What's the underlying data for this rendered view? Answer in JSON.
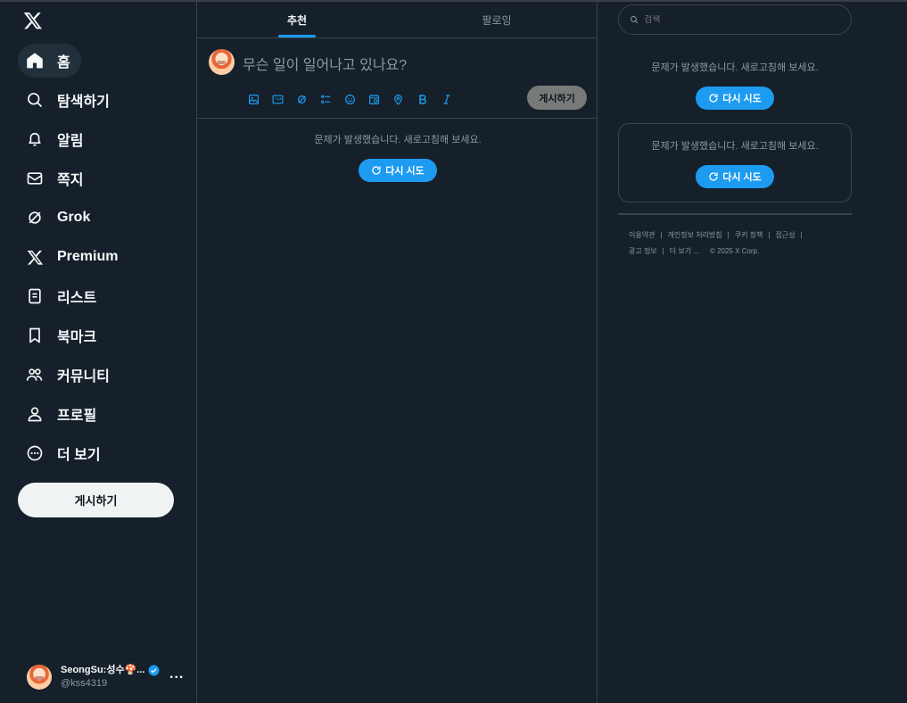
{
  "sidebar": {
    "logo": "x-logo-icon",
    "items": [
      {
        "label": "홈",
        "icon": "home-icon",
        "active": true
      },
      {
        "label": "탐색하기",
        "icon": "search-icon"
      },
      {
        "label": "알림",
        "icon": "bell-icon"
      },
      {
        "label": "쪽지",
        "icon": "mail-icon"
      },
      {
        "label": "Grok",
        "icon": "grok-icon"
      },
      {
        "label": "Premium",
        "icon": "x-icon"
      },
      {
        "label": "리스트",
        "icon": "list-icon"
      },
      {
        "label": "북마크",
        "icon": "bookmark-icon"
      },
      {
        "label": "커뮤니티",
        "icon": "communities-icon"
      },
      {
        "label": "프로필",
        "icon": "person-icon"
      },
      {
        "label": "더 보기",
        "icon": "more-circle-icon"
      }
    ],
    "post_label": "게시하기",
    "account": {
      "name": "SeongSu:성수🍄...",
      "handle": "@kss4319",
      "more": "..."
    }
  },
  "main": {
    "tabs": [
      {
        "label": "추천",
        "active": true
      },
      {
        "label": "팔로잉",
        "active": false
      }
    ],
    "composer": {
      "placeholder": "무슨 일이 일어나고 있나요?",
      "post_label": "게시하기",
      "tools": [
        "image-icon",
        "gif-icon",
        "grok-icon",
        "poll-icon",
        "emoji-icon",
        "schedule-icon",
        "location-icon",
        "bold-icon",
        "italic-icon"
      ]
    },
    "error": "문제가 발생했습니다. 새로고침해 보세요.",
    "retry": "다시 시도"
  },
  "right": {
    "search_placeholder": "검색",
    "error1": "문제가 발생했습니다. 새로고침해 보세요.",
    "retry1": "다시 시도",
    "error2": "문제가 발생했습니다. 새로고침해 보세요.",
    "retry2": "다시 시도",
    "footer": {
      "terms": "이용약관",
      "privacy": "개인정보 처리방침",
      "cookies": "쿠키 정책",
      "accessibility": "접근성",
      "ads": "광고 정보",
      "more": "더 보기 ...",
      "copyright": "© 2025 X Corp."
    }
  },
  "colors": {
    "background": "#15202b",
    "accent": "#1d9bf0",
    "border": "#38444d",
    "muted": "#8b98a5"
  }
}
